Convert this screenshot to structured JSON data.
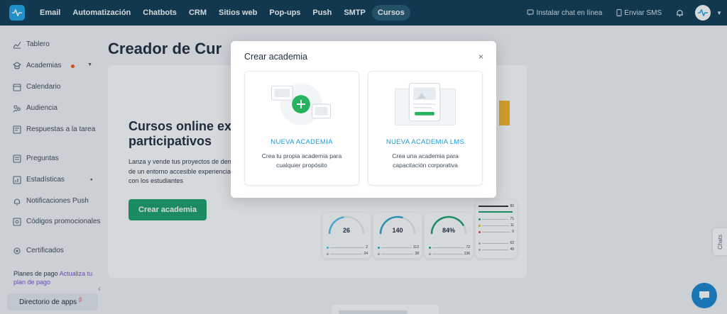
{
  "topbar": {
    "nav": [
      {
        "label": "Email",
        "active": false
      },
      {
        "label": "Automatización",
        "active": false
      },
      {
        "label": "Chatbots",
        "active": false
      },
      {
        "label": "CRM",
        "active": false
      },
      {
        "label": "Sitios web",
        "active": false
      },
      {
        "label": "Pop-ups",
        "active": false
      },
      {
        "label": "Push",
        "active": false
      },
      {
        "label": "SMTP",
        "active": false
      },
      {
        "label": "Cursos",
        "active": true
      }
    ],
    "install_chat": "Instalar chat en línea",
    "send_sms": "Enviar SMS"
  },
  "sidebar": {
    "items": [
      {
        "label": "Tablero",
        "icon": "chart-line-icon"
      },
      {
        "label": "Academias",
        "icon": "academy-icon"
      },
      {
        "label": "Calendario",
        "icon": "calendar-icon"
      },
      {
        "label": "Audiencia",
        "icon": "audience-icon"
      },
      {
        "label": "Respuestas a la tarea",
        "icon": "answers-icon"
      },
      {
        "label": "Preguntas",
        "icon": "questions-icon"
      },
      {
        "label": "Estadísticas",
        "icon": "stats-icon"
      },
      {
        "label": "Notificaciones Push",
        "icon": "bell-icon"
      },
      {
        "label": "Códigos promocionales",
        "icon": "promo-icon"
      },
      {
        "label": "Certificados",
        "icon": "certificate-icon"
      }
    ],
    "plan_text": "Planes de pago",
    "plan_link": "Actualiza tu plan de pago",
    "directory": "Directorio de apps",
    "directory_badge": "β"
  },
  "main": {
    "page_title": "Creador de Cur",
    "hero_title": "Cursos online ex participativos",
    "hero_text": "Lanza y vende tus proyectos de dentro de un entorno accesible experiencia con los estudiantes",
    "hero_button": "Crear academia",
    "stats": [
      {
        "value": "26",
        "row1": "2",
        "row2": "24",
        "progress": 0.45,
        "color": "#4fc3e8"
      },
      {
        "value": "140",
        "row1": "112",
        "row2": "28",
        "progress": 0.6,
        "color": "#2aa6c9"
      },
      {
        "value": "84%",
        "row1": "72",
        "row2": "136",
        "progress": 0.84,
        "color": "#1ca26a"
      }
    ],
    "list_values": [
      "82",
      "71",
      "11",
      "0",
      "62",
      "49"
    ]
  },
  "modal": {
    "title": "Crear academia",
    "close": "×",
    "options": [
      {
        "title": "NUEVA ACADEMIA",
        "desc": "Crea tu propia academia para cualquier propósito"
      },
      {
        "title": "NUEVA ACADEMIA LMS",
        "desc": "Crea una academia para capacitación corporativa"
      }
    ]
  },
  "chats_tab": "Chats",
  "colors": {
    "topbar": "#0f3b52",
    "accent": "#1e9ad6",
    "primary_button": "#1ca26a"
  }
}
